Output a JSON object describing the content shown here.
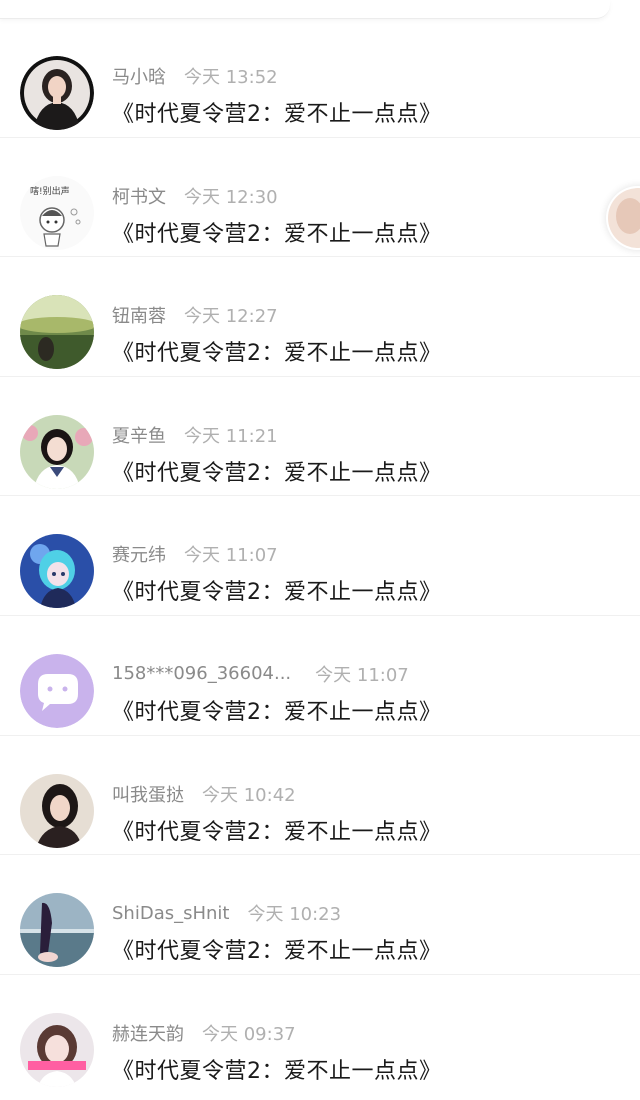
{
  "messages": [
    {
      "name": "马小晗",
      "time": "今天 13:52",
      "text": "《时代夏令营2：爱不止一点点》",
      "avatar": "photo-avatar-woman"
    },
    {
      "name": "柯书文",
      "time": "今天 12:30",
      "text": "《时代夏令营2：爱不止一点点》",
      "avatar": "sketch-avatar"
    },
    {
      "name": "钮南蓉",
      "time": "今天 12:27",
      "text": "《时代夏令营2：爱不止一点点》",
      "avatar": "landscape-avatar"
    },
    {
      "name": "夏辛鱼",
      "time": "今天 11:21",
      "text": "《时代夏令营2：爱不止一点点》",
      "avatar": "photo-avatar-girl"
    },
    {
      "name": "赛元纬",
      "time": "今天 11:07",
      "text": "《时代夏令营2：爱不止一点点》",
      "avatar": "anime-avatar"
    },
    {
      "name": "158***096_36604...",
      "time": "今天 11:07",
      "text": "《时代夏令营2：爱不止一点点》",
      "avatar": "chat-bubble-icon"
    },
    {
      "name": "叫我蛋挞",
      "time": "今天 10:42",
      "text": "《时代夏令营2：爱不止一点点》",
      "avatar": "photo-avatar-woman-2"
    },
    {
      "name": "ShiDas_sHnit",
      "time": "今天 10:23",
      "text": "《时代夏令营2：爱不止一点点》",
      "avatar": "beach-avatar"
    },
    {
      "name": "赫连天韵",
      "time": "今天 09:37",
      "text": "《时代夏令营2：爱不止一点点》",
      "avatar": "photo-avatar-girl-2"
    }
  ],
  "colors": {
    "name_text": "#8a8a8a",
    "time_text": "#b0b0b0",
    "message_text": "#1a1a1a",
    "chat_avatar_bg": "#c9b3ec"
  }
}
